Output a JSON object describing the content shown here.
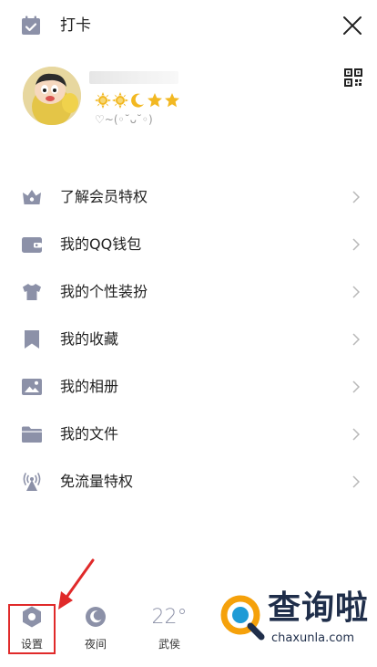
{
  "header": {
    "checkin_label": "打卡",
    "checkin_icon": "calendar-check-icon",
    "close_icon": "close-icon"
  },
  "profile": {
    "level_icons": [
      "sun-icon",
      "sun-icon",
      "moon-icon",
      "star-icon",
      "star-icon"
    ],
    "signature": "♡~(◦˘ᴗ˘◦)",
    "qr_icon": "qr-code-icon",
    "level_color": "#f2b822"
  },
  "menu": {
    "items": [
      {
        "label": "了解会员特权",
        "icon": "crown-icon"
      },
      {
        "label": "我的QQ钱包",
        "icon": "wallet-icon"
      },
      {
        "label": "我的个性装扮",
        "icon": "shirt-icon"
      },
      {
        "label": "我的收藏",
        "icon": "bookmark-icon"
      },
      {
        "label": "我的相册",
        "icon": "image-icon"
      },
      {
        "label": "我的文件",
        "icon": "folder-icon"
      },
      {
        "label": "免流量特权",
        "icon": "signal-tower-icon"
      }
    ],
    "icon_color": "#8c91a8"
  },
  "bottom": {
    "settings_label": "设置",
    "night_label": "夜间",
    "temperature": "22°",
    "city": "武侯"
  },
  "annotation": {
    "highlight_color": "#e02a2a"
  },
  "watermark": {
    "cn": "查询啦",
    "en": "chaxunla.com",
    "logo_color": "#f5a10b"
  }
}
